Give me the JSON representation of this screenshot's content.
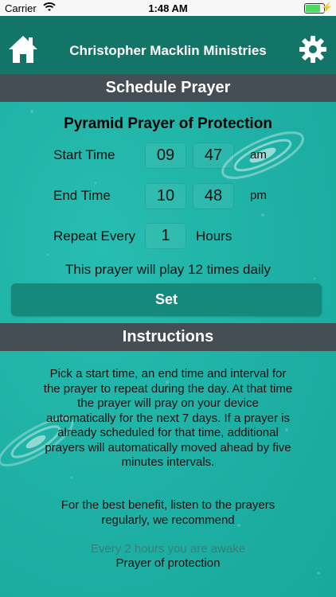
{
  "status_bar": {
    "carrier": "Carrier",
    "time": "1:48 AM"
  },
  "header": {
    "title": "Christopher Macklin Ministries"
  },
  "schedule": {
    "section_title": "Schedule Prayer",
    "prayer_name": "Pyramid Prayer of Protection",
    "start_label": "Start Time",
    "start_hour": "09",
    "start_minute": "47",
    "start_ampm": "am",
    "end_label": "End Time",
    "end_hour": "10",
    "end_minute": "48",
    "end_ampm": "pm",
    "repeat_label": "Repeat Every",
    "repeat_value": "1",
    "repeat_unit": "Hours",
    "summary": "This prayer will play 12 times daily",
    "set_label": "Set"
  },
  "instructions": {
    "section_title": "Instructions",
    "paragraph1_lines": [
      "Pick a start time, an end time and interval for",
      "the prayer to repeat during the day. At that time",
      "the prayer will pray on your device",
      "automatically for the next 7 days. If a prayer is",
      "already scheduled for that time, additional",
      "prayers will automatically moved ahead by five",
      "minutes intervals."
    ],
    "paragraph2_lines": [
      "For the best benefit, listen to the prayers",
      "regularly, we recommend"
    ],
    "recommend_line1": "Every 2 hours you are awake",
    "recommend_line2": "Prayer of protection"
  },
  "colors": {
    "background": "#1fb1a5",
    "nav": "#127567",
    "section_bar": "#444e54",
    "button": "#14897c"
  }
}
